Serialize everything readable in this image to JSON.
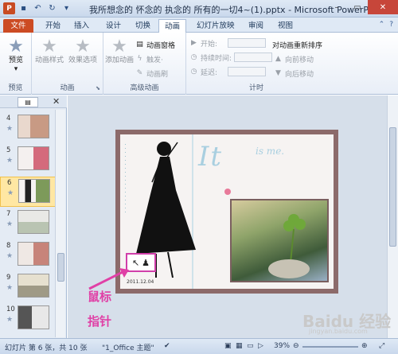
{
  "window": {
    "title": "我所想念的 怀念的 执念的 所有的一切4~(1).pptx - Microsoft PowerPoi...",
    "qat_icons": [
      "powerpoint-app-icon",
      "save-icon",
      "undo-icon",
      "redo-icon",
      "customize-qat-icon"
    ],
    "controls": [
      "minimize",
      "maximize",
      "close"
    ]
  },
  "ribbon": {
    "tabs": [
      "文件",
      "开始",
      "插入",
      "设计",
      "切换",
      "动画",
      "幻灯片放映",
      "审阅",
      "视图"
    ],
    "active_tab": "动画",
    "groups": {
      "preview": {
        "button": "预览",
        "label": "预览"
      },
      "animation": {
        "buttons": [
          "动画样式",
          "效果选项"
        ],
        "label": "动画"
      },
      "advanced": {
        "add_button": "添加动画",
        "pane": "动画窗格",
        "trigger": "触发·",
        "painter": "动画刷",
        "label": "高级动画"
      },
      "timing": {
        "start_label": "开始:",
        "duration_label": "持续时间:",
        "delay_label": "延迟:",
        "reorder_title": "对动画重新排序",
        "move_earlier": "向前移动",
        "move_later": "向后移动",
        "label": "计时"
      }
    }
  },
  "slides_pane": {
    "slides": [
      {
        "num": "4",
        "selected": false
      },
      {
        "num": "5",
        "selected": false
      },
      {
        "num": "6",
        "selected": true
      },
      {
        "num": "7",
        "selected": false
      },
      {
        "num": "8",
        "selected": false
      },
      {
        "num": "9",
        "selected": false
      },
      {
        "num": "10",
        "selected": false
      }
    ]
  },
  "slide": {
    "title_script": "It",
    "subtitle_script": "is me.",
    "date": "2011.12.04"
  },
  "annotation": {
    "line1": "鼠标",
    "line2": "指针"
  },
  "statusbar": {
    "slide_info": "幻灯片 第 6 张，共 10 张",
    "theme": "\"1_Office 主题\"",
    "zoom": "39%"
  },
  "watermark": {
    "brand": "Baidu 经验",
    "url": "jingyan.baidu.com"
  }
}
